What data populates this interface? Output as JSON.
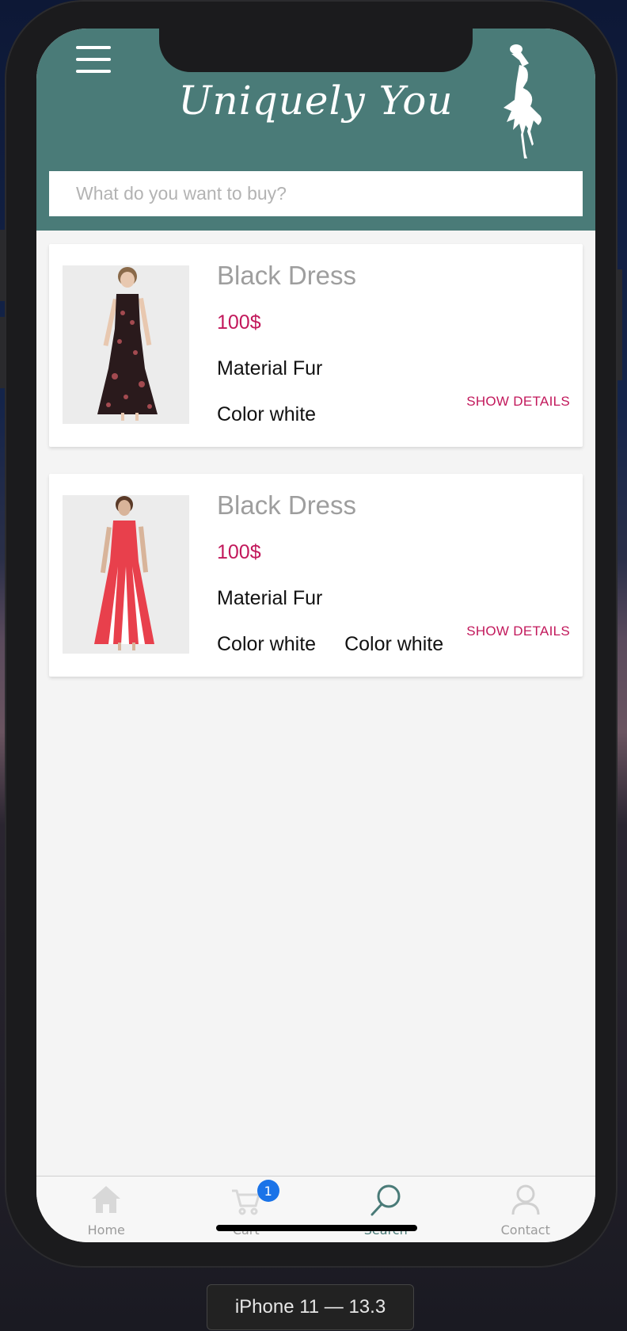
{
  "header": {
    "brand": "Uniquely You",
    "search_placeholder": "What do you want to buy?"
  },
  "products": [
    {
      "title": "Black Dress",
      "price": "100$",
      "material": "Material Fur",
      "colors": [
        "Color white"
      ],
      "action": "SHOW DETAILS",
      "dress_colors": [
        "#2a1a1c",
        "#a34a50"
      ]
    },
    {
      "title": "Black Dress",
      "price": "100$",
      "material": "Material Fur",
      "colors": [
        "Color white",
        "Color white"
      ],
      "action": "SHOW DETAILS",
      "dress_colors": [
        "#e8404c",
        "#ffffff"
      ]
    }
  ],
  "tabbar": {
    "items": [
      {
        "label": "Home",
        "icon": "home-icon",
        "active": false
      },
      {
        "label": "Cart",
        "icon": "cart-icon",
        "active": false,
        "badge": "1"
      },
      {
        "label": "Search",
        "icon": "search-icon",
        "active": true
      },
      {
        "label": "Contact",
        "icon": "person-icon",
        "active": false
      }
    ]
  },
  "simulator": {
    "label": "iPhone 11 — 13.3"
  },
  "colors": {
    "header": "#4a7b78",
    "accent": "#c2185b",
    "badge": "#1a73e8"
  }
}
